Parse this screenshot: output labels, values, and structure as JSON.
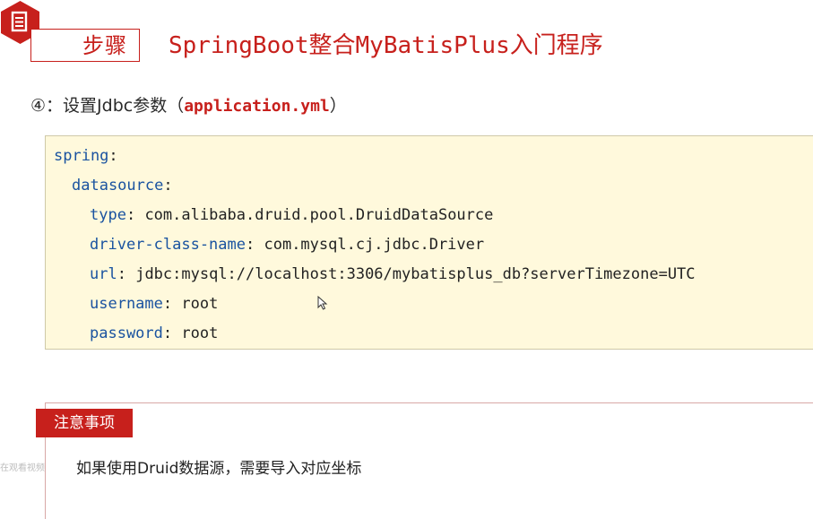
{
  "header": {
    "icon": "list-doc-icon",
    "step_label": "步骤",
    "title": "SpringBoot整合MyBatisPlus入门程序"
  },
  "step": {
    "number": "④",
    "text": "：设置Jdbc参数（",
    "filename": "application.yml",
    "close": "）"
  },
  "code": {
    "lines": [
      {
        "key": "spring",
        "sep": ":",
        "value": ""
      },
      {
        "key": "datasource",
        "sep": ":",
        "value": ""
      },
      {
        "key": "type",
        "sep": ": ",
        "value": "com.alibaba.druid.pool.DruidDataSource"
      },
      {
        "key": "driver-class-name",
        "sep": ": ",
        "value": "com.mysql.cj.jdbc.Driver"
      },
      {
        "key": "url",
        "sep": ": ",
        "value": "jdbc:mysql://localhost:3306/mybatisplus_db?serverTimezone=UTC"
      },
      {
        "key": "username",
        "sep": ": ",
        "value": "root"
      },
      {
        "key": "password",
        "sep": ": ",
        "value": "root"
      }
    ]
  },
  "note": {
    "tag": "注意事项",
    "text": "如果使用Druid数据源，需要导入对应坐标"
  },
  "watermark": "在观看视频",
  "colors": {
    "accent": "#c7201c",
    "code_bg": "#fff9dc",
    "code_key": "#1a53a0"
  }
}
